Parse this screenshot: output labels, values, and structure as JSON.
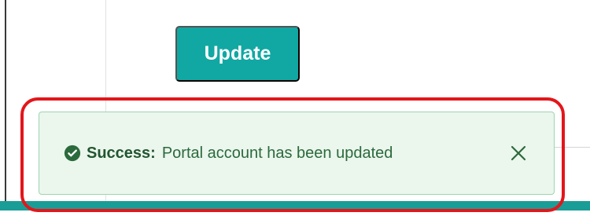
{
  "form": {
    "update_label": "Update"
  },
  "toast": {
    "status_label": "Success:",
    "message": "Portal account has been updated",
    "close_icon": "close-icon",
    "success_icon": "check-circle-icon"
  },
  "colors": {
    "primary": "#11a8a3",
    "success_background": "#ebf6ed",
    "success_border": "#9ed5ae",
    "success_text": "#2b6a3c",
    "success_label": "#21562f",
    "annotation": "#e3161b",
    "bottom_band": "#1a9d97"
  }
}
